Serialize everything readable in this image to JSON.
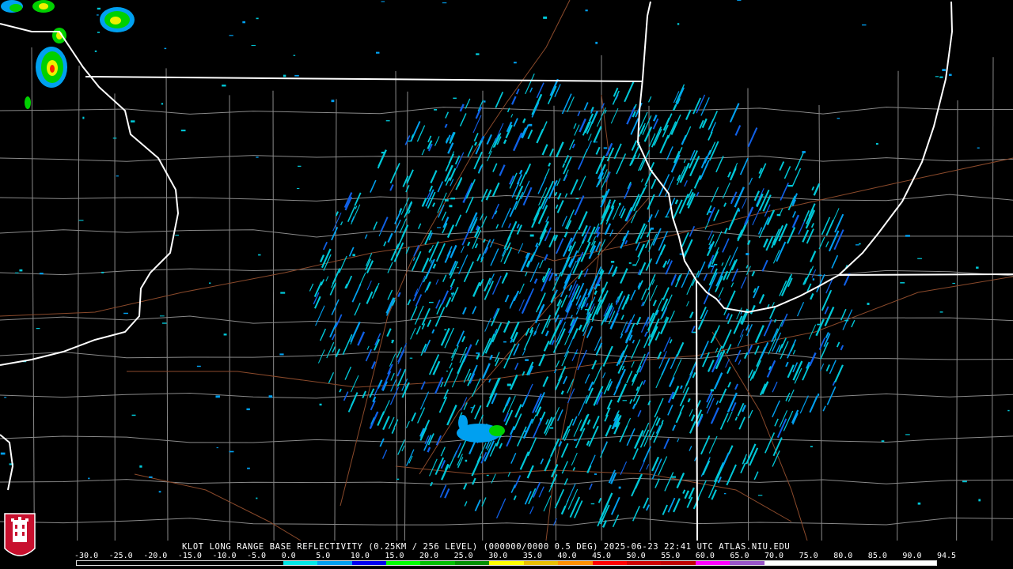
{
  "product": {
    "title": "KLOT LONG RANGE BASE REFLECTIVITY (0.25KM / 256 LEVEL) (000000/0000 0.5 DEG) 2025-06-23 22:41 UTC  ATLAS.NIU.EDU"
  },
  "colorbar": {
    "tick_labels": [
      "-30.0",
      "-25.0",
      "-20.0",
      "-15.0",
      "-10.0",
      "-5.0",
      "0.0",
      "5.0",
      "10.0",
      "15.0",
      "20.0",
      "25.0",
      "30.0",
      "35.0",
      "40.0",
      "45.0",
      "50.0",
      "55.0",
      "60.0",
      "65.0",
      "70.0",
      "75.0",
      "80.0",
      "85.0",
      "90.0",
      "94.5"
    ],
    "segment_colors": [
      "#000000",
      "#000000",
      "#000000",
      "#000000",
      "#000000",
      "#000000",
      "#00e8e8",
      "#00a0f0",
      "#0000f0",
      "#00ff00",
      "#00c000",
      "#009000",
      "#ffff00",
      "#e8c000",
      "#ff9000",
      "#ff0000",
      "#d00000",
      "#c00000",
      "#ff00ff",
      "#9955c9",
      "#ffffff",
      "#ffffff",
      "#ffffff",
      "#ffffff",
      "#ffffff"
    ]
  },
  "map": {
    "radar_site": "KLOT",
    "echo_colors": {
      "light": "#00c8d8",
      "medium": "#00a0f0",
      "strong": "#1060e8",
      "green": "#00d000",
      "yellow": "#f0f000",
      "red": "#ff2000"
    },
    "boundary_colors": {
      "state_line": "#ffffff",
      "county_line": "#8a8a8a",
      "highway": "#8b4a2b"
    }
  },
  "logo": {
    "text": "NIU",
    "colors": {
      "shield": "#c8102e",
      "tower": "#ffffff"
    }
  }
}
